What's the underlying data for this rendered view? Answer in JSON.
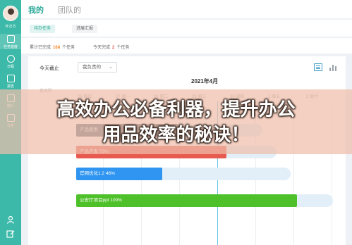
{
  "sidebar": {
    "user_name": "叶次方",
    "items": [
      {
        "label": "任务首度",
        "icon": "grid-icon"
      },
      {
        "label": "日程",
        "icon": "clock-icon"
      },
      {
        "label": "报告",
        "icon": "document-icon"
      },
      {
        "label": "统计",
        "icon": "chart-icon"
      },
      {
        "label": "分析",
        "icon": "sitemap-icon"
      }
    ],
    "bottom_icons": [
      "user-icon",
      "edit-icon"
    ]
  },
  "header": {
    "tabs": [
      {
        "label": "我的",
        "active": true
      },
      {
        "label": "团队的",
        "active": false
      }
    ]
  },
  "subtabs": [
    {
      "label": "待办任务",
      "active": true
    },
    {
      "label": "进展汇报",
      "active": false
    }
  ],
  "stats": {
    "total_prefix": "累计已完成",
    "total_count": "168",
    "total_suffix": "个任务",
    "today_prefix": "今天完成",
    "today_count": "2",
    "today_suffix": "个任务"
  },
  "panel": {
    "deadline_label": "今天截止",
    "filter_value": "我负责的",
    "month": "2021年4月",
    "risk_label": "有风险",
    "days": [
      "26 周日",
      "27 周一",
      "28 周二",
      "29 周三",
      "30 周四",
      "1 周五",
      "2 周六"
    ],
    "tasks": [
      {
        "name": "产品使用",
        "percent": "",
        "progress": 0.38,
        "color": "#556573"
      },
      {
        "name": "产品开发",
        "percent": "73%",
        "progress": 0.73,
        "color": "#e85a4f"
      },
      {
        "name": "官网优化1.2",
        "percent": "46%",
        "progress": 0.46,
        "color": "#2f95f0"
      },
      {
        "name": "公安厅项目ppt",
        "percent": "100%",
        "progress": 1.0,
        "color": "#4ec12a"
      }
    ]
  },
  "banner": {
    "line1": "高效办公必备利器，提升办公",
    "line2": "用品效率的秘诀！"
  },
  "colors": {
    "accent": "#3cb9a8",
    "orange": "#f08a2a",
    "red": "#e05a4f",
    "blue": "#2f95f0",
    "green": "#4ec12a"
  }
}
